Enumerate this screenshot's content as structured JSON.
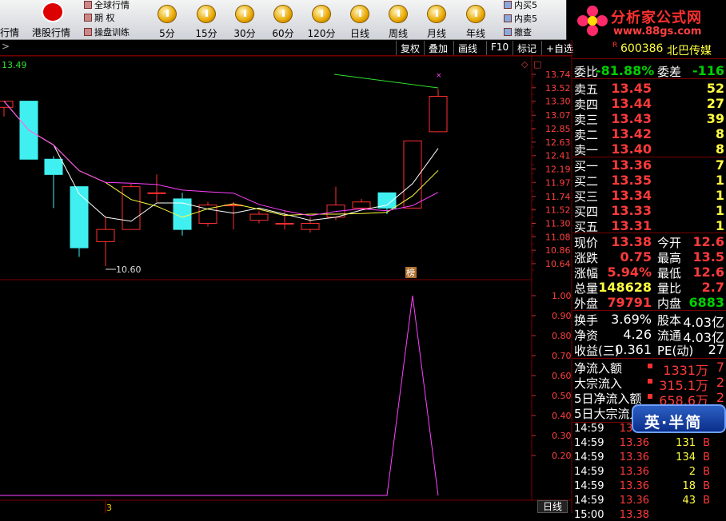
{
  "toolbar": {
    "left_cut_label": "行情",
    "hk_label": "港股行情",
    "menu_global": "全球行情",
    "menu_option": "期 权",
    "menu_training": "操盘训练",
    "periods": [
      "5分",
      "15分",
      "30分",
      "60分",
      "120分",
      "日线",
      "周线",
      "月线",
      "年线"
    ],
    "right_items": [
      "内买5",
      "内卖5",
      "撤查"
    ]
  },
  "logo": {
    "title": "分析家公式网",
    "url": "www.88gs.com"
  },
  "chart_toolbar": {
    "buttons": [
      "复权",
      "叠加",
      "画线",
      "F10",
      "标记",
      "+自选"
    ],
    "ref_price": "13.49"
  },
  "price_axis": [
    "13.74",
    "13.52",
    "13.30",
    "13.07",
    "12.85",
    "12.63",
    "12.41",
    "12.19",
    "11.97",
    "11.74",
    "11.52",
    "11.30",
    "11.08",
    "10.86",
    "10.64"
  ],
  "indicator_axis": [
    "1.00",
    "0.90",
    "0.80",
    "0.70",
    "0.60",
    "0.50",
    "0.40",
    "0.30",
    "0.20"
  ],
  "chart_data": {
    "type": "candlestick",
    "ylim": [
      10.6,
      13.74
    ],
    "low_marker": "10.60",
    "tag": "榜",
    "candles": [
      {
        "o": 13.2,
        "c": 13.3,
        "h": 13.3,
        "l": 13.05
      },
      {
        "o": 13.3,
        "c": 12.35,
        "h": 13.3,
        "l": 12.35
      },
      {
        "o": 12.35,
        "c": 12.1,
        "h": 12.4,
        "l": 11.55
      },
      {
        "o": 11.9,
        "c": 10.9,
        "h": 11.9,
        "l": 10.75
      },
      {
        "o": 11.0,
        "c": 11.2,
        "h": 11.4,
        "l": 10.6
      },
      {
        "o": 11.2,
        "c": 11.9,
        "h": 11.95,
        "l": 11.2
      },
      {
        "o": 11.8,
        "c": 11.8,
        "h": 12.1,
        "l": 11.65
      },
      {
        "o": 11.7,
        "c": 11.2,
        "h": 11.8,
        "l": 11.1
      },
      {
        "o": 11.3,
        "c": 11.6,
        "h": 11.65,
        "l": 11.25
      },
      {
        "o": 11.6,
        "c": 11.6,
        "h": 11.65,
        "l": 11.2
      },
      {
        "o": 11.35,
        "c": 11.45,
        "h": 11.5,
        "l": 11.3
      },
      {
        "o": 11.3,
        "c": 11.3,
        "h": 11.5,
        "l": 11.2
      },
      {
        "o": 11.2,
        "c": 11.3,
        "h": 11.4,
        "l": 11.15
      },
      {
        "o": 11.4,
        "c": 11.6,
        "h": 11.9,
        "l": 11.35
      },
      {
        "o": 11.55,
        "c": 11.65,
        "h": 11.7,
        "l": 11.55
      },
      {
        "o": 11.8,
        "c": 11.55,
        "h": 11.8,
        "l": 11.45
      },
      {
        "o": 11.55,
        "c": 12.65,
        "h": 12.65,
        "l": 11.55
      },
      {
        "o": 12.8,
        "c": 13.38,
        "h": 13.5,
        "l": 12.8
      }
    ],
    "indicator": {
      "ylim": [
        0,
        1.05
      ],
      "values": [
        0,
        0,
        0,
        0,
        0,
        0,
        0,
        0,
        0,
        0,
        0,
        0,
        0,
        0,
        0,
        0,
        1,
        0
      ]
    }
  },
  "quote": {
    "code": "600386",
    "name": "北巴传媒",
    "wei_bi_label": "委比",
    "wei_bi": "-81.88%",
    "wei_cha_label": "委差",
    "wei_cha": "-116",
    "asks": [
      {
        "label": "卖五",
        "price": "13.45",
        "vol": "52"
      },
      {
        "label": "卖四",
        "price": "13.44",
        "vol": "27"
      },
      {
        "label": "卖三",
        "price": "13.43",
        "vol": "39"
      },
      {
        "label": "卖二",
        "price": "13.42",
        "vol": "8"
      },
      {
        "label": "卖一",
        "price": "13.40",
        "vol": "8"
      }
    ],
    "bids": [
      {
        "label": "买一",
        "price": "13.36",
        "vol": "7"
      },
      {
        "label": "买二",
        "price": "13.35",
        "vol": "1"
      },
      {
        "label": "买三",
        "price": "13.34",
        "vol": "1"
      },
      {
        "label": "买四",
        "price": "13.33",
        "vol": "1"
      },
      {
        "label": "买五",
        "price": "13.31",
        "vol": "1"
      }
    ],
    "stats": [
      {
        "l1": "现价",
        "v1": "13.38",
        "c1": "r",
        "l2": "今开",
        "v2": "12.6",
        "c2": "r"
      },
      {
        "l1": "涨跌",
        "v1": "0.75",
        "c1": "r",
        "l2": "最高",
        "v2": "13.5",
        "c2": "r"
      },
      {
        "l1": "涨幅",
        "v1": "5.94%",
        "c1": "r",
        "l2": "最低",
        "v2": "12.6",
        "c2": "r"
      },
      {
        "l1": "总量",
        "v1": "148628",
        "c1": "y",
        "l2": "量比",
        "v2": "2.7",
        "c2": "r"
      },
      {
        "l1": "外盘",
        "v1": "79791",
        "c1": "r",
        "l2": "内盘",
        "v2": "6883",
        "c2": "g"
      }
    ],
    "stats2": [
      {
        "l1": "换手",
        "v1": "3.69%",
        "l2": "股本",
        "v2": "4.03亿"
      },
      {
        "l1": "净资",
        "v1": "4.26",
        "l2": "流通",
        "v2": "4.03亿"
      },
      {
        "l1": "收益(三)",
        "v1": "0.361",
        "l2": "PE(动)",
        "v2": "27"
      }
    ],
    "flows": [
      {
        "label": "净流入额",
        "value": "1331万",
        "extra": "7"
      },
      {
        "label": "大宗流入",
        "value": "315.1万",
        "extra": "2"
      },
      {
        "label": "5日净流入额",
        "value": "658.6万",
        "extra": "2"
      },
      {
        "label": "5日大宗流入",
        "value": "",
        "extra": ""
      }
    ],
    "ticks": [
      {
        "time": "14:59",
        "price": "13.36",
        "vol": "",
        "bs": ""
      },
      {
        "time": "14:59",
        "price": "13.36",
        "vol": "131",
        "bs": "B"
      },
      {
        "time": "14:59",
        "price": "13.36",
        "vol": "134",
        "bs": "B"
      },
      {
        "time": "14:59",
        "price": "13.36",
        "vol": "2",
        "bs": "B"
      },
      {
        "time": "14:59",
        "price": "13.36",
        "vol": "18",
        "bs": "B"
      },
      {
        "time": "14:59",
        "price": "13.36",
        "vol": "43",
        "bs": "B"
      },
      {
        "time": "15:00",
        "price": "13.38",
        "vol": "",
        "bs": ""
      }
    ]
  },
  "ime_badge": "英·半简",
  "bottom": {
    "period_label": "日线",
    "marker": "3"
  }
}
